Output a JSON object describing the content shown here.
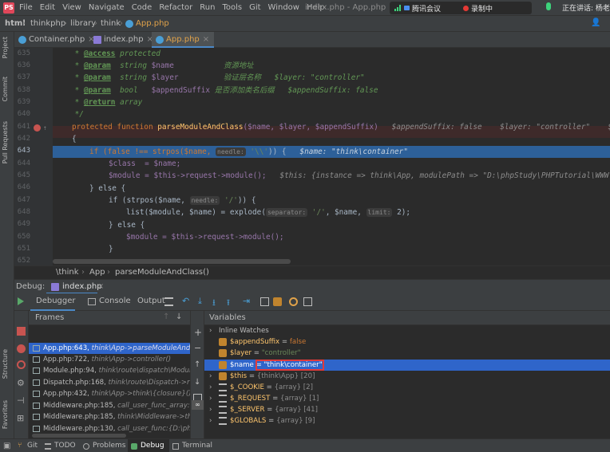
{
  "menu": [
    "File",
    "Edit",
    "View",
    "Navigate",
    "Code",
    "Refactor",
    "Run",
    "Tools",
    "Git",
    "Window",
    "Help"
  ],
  "window_title": "index.php - App.php",
  "meeting": {
    "app": "腾讯会议",
    "recording": "录制中",
    "speaking": "正在讲话: 杨老"
  },
  "nav_breadcrumb": [
    "html",
    "thinkphp",
    "library",
    "think",
    "App.php"
  ],
  "tabs": [
    {
      "label": "Container.php",
      "active": false
    },
    {
      "label": "index.php",
      "active": false
    },
    {
      "label": "App.php",
      "active": true
    }
  ],
  "side_labels": [
    "Project",
    "Commit",
    "Pull Requests"
  ],
  "line_numbers": [
    "635",
    "636",
    "637",
    "638",
    "639",
    "640",
    "641",
    "642",
    "643",
    "644",
    "645",
    "646",
    "647",
    "648",
    "649",
    "650",
    "651",
    "652"
  ],
  "code": {
    "l635": {
      "tag": "@access",
      "rest": " protected"
    },
    "l636": {
      "tag": "@param",
      "type": "  string ",
      "var": "$name",
      "cmt": "           资源地址"
    },
    "l637": {
      "tag": "@param",
      "type": "  string ",
      "var": "$layer",
      "cmt": "          验证层名称   $layer: \"controller\""
    },
    "l638": {
      "tag": "@param",
      "type": "  bool   ",
      "var": "$appendSuffix",
      "cmt": " 是否添加类名后缀   $appendSuffix: false"
    },
    "l639": {
      "tag": "@return",
      "rest": " array"
    },
    "l640": "*/",
    "l641": {
      "kw": "protected function ",
      "fn": "parseModuleAndClass",
      "args": "($name, $layer, $appendSuffix)",
      "hint": "   $appendSuffix: false    $layer: \"controller\"    $n"
    },
    "l642": "{",
    "l643": {
      "a": "if (false !== strpos($name, ",
      "ph": "needle:",
      "s": " '\\\\'",
      "b": ")) {",
      "hint": "   $name: \"think\\container\""
    },
    "l644": "$class  = $name;",
    "l645": {
      "a": "$module = $this->request->module();",
      "hint": "   $this: {instance => think\\App, modulePath => \"D:\\phpStudy\\PHPTutorial\\WWW\\"
    },
    "l646": "} else {",
    "l647": {
      "a": "if (strpos($name, ",
      "ph": "needle:",
      "s": " '/'",
      "b": ")) {"
    },
    "l648": {
      "a": "list($module, $name) = explode(",
      "ph": "separator:",
      "s": " '/'",
      "b": ", $name, ",
      "ph2": "limit:",
      "n": " 2);"
    },
    "l649": "} else {",
    "l650": "$module = $this->request->module();",
    "l651": "}"
  },
  "editor_breadcrumb": [
    "\\think",
    "App",
    "parseModuleAndClass()"
  ],
  "debug": {
    "label": "Debug:",
    "session": "index.php",
    "tabs": [
      "Debugger",
      "Console",
      "Output"
    ],
    "frames_title": "Frames",
    "variables_title": "Variables",
    "frames": [
      {
        "file": "App.php:643,",
        "detail": " think\\App->parseModuleAndCl",
        "selected": true
      },
      {
        "file": "App.php:722,",
        "detail": " think\\App->controller()",
        "selected": false
      },
      {
        "file": "Module.php:94,",
        "detail": " think\\route\\dispatch\\Modul",
        "selected": false
      },
      {
        "file": "Dispatch.php:168,",
        "detail": " think\\route\\Dispatch->ru",
        "selected": false
      },
      {
        "file": "App.php:432,",
        "detail": " think\\App->think\\{closure}()",
        "selected": false
      },
      {
        "file": "Middleware.php:185,",
        "detail": " call_user_func_array:{D:",
        "selected": false
      },
      {
        "file": "Middleware.php:185,",
        "detail": " think\\Middleware->thi",
        "selected": false
      },
      {
        "file": "Middleware.php:130,",
        "detail": " call_user_func:{D:\\php5",
        "selected": false
      }
    ],
    "variables": [
      {
        "name": "Inline Watches",
        "eq": "",
        "value": "",
        "kind": "group",
        "expand": true
      },
      {
        "name": "$appendSuffix",
        "eq": " = ",
        "value": "false",
        "kind": "kw"
      },
      {
        "name": "$layer",
        "eq": " = ",
        "value": "\"controller\"",
        "kind": "str"
      },
      {
        "name": "$name",
        "eq": " = ",
        "value": "\"think\\container\"",
        "kind": "str",
        "selected": true
      },
      {
        "name": "$this",
        "eq": " = ",
        "value": "{think\\App} [20]",
        "kind": "type",
        "expand": true
      },
      {
        "name": "$_COOKIE",
        "eq": " = ",
        "value": "{array} [2]",
        "kind": "type",
        "expand": true
      },
      {
        "name": "$_REQUEST",
        "eq": " = ",
        "value": "{array} [1]",
        "kind": "type",
        "expand": true
      },
      {
        "name": "$_SERVER",
        "eq": " = ",
        "value": "{array} [41]",
        "kind": "type",
        "expand": true
      },
      {
        "name": "$GLOBALS",
        "eq": " = ",
        "value": "{array} [9]",
        "kind": "type",
        "expand": true
      }
    ],
    "left_labels": [
      "Structure",
      "Favorites"
    ]
  },
  "status": [
    "Git",
    "TODO",
    "Problems",
    "Debug",
    "Terminal"
  ],
  "colors": {
    "accent": "#2f65ca",
    "highlight": "#e03b3b",
    "tab_active": "#4a88c7"
  }
}
